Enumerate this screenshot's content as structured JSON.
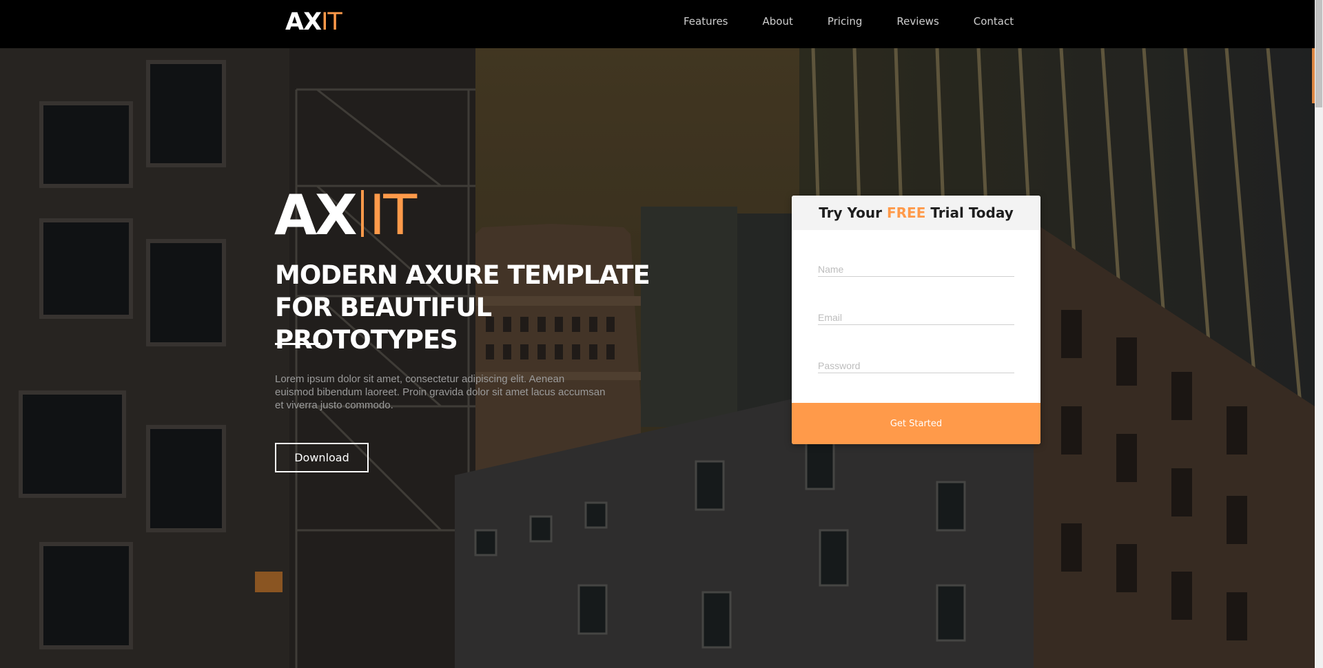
{
  "nav": {
    "brand_part1": "AX",
    "brand_part2": "IT",
    "links": [
      "Features",
      "About",
      "Pricing",
      "Reviews",
      "Contact"
    ]
  },
  "hero": {
    "logo_part1": "AX",
    "logo_part2": "IT",
    "headline_line1": "MODERN AXURE TEMPLATE",
    "headline_line2": "FOR BEAUTIFUL PROTOTYPES",
    "description": "Lorem ipsum dolor sit amet, consectetur adipiscing elit. Aenean euismod bibendum laoreet. Proin gravida dolor sit amet lacus accumsan et viverra justo commodo.",
    "download_label": "Download"
  },
  "trial_form": {
    "title_before": "Try Your ",
    "title_highlight": "FREE",
    "title_after": " Trial Today",
    "name_placeholder": "Name",
    "email_placeholder": "Email",
    "password_placeholder": "Password",
    "submit_label": "Get Started"
  },
  "colors": {
    "accent": "#ff9a4a",
    "navbar": "#000000",
    "card": "#ffffff"
  }
}
